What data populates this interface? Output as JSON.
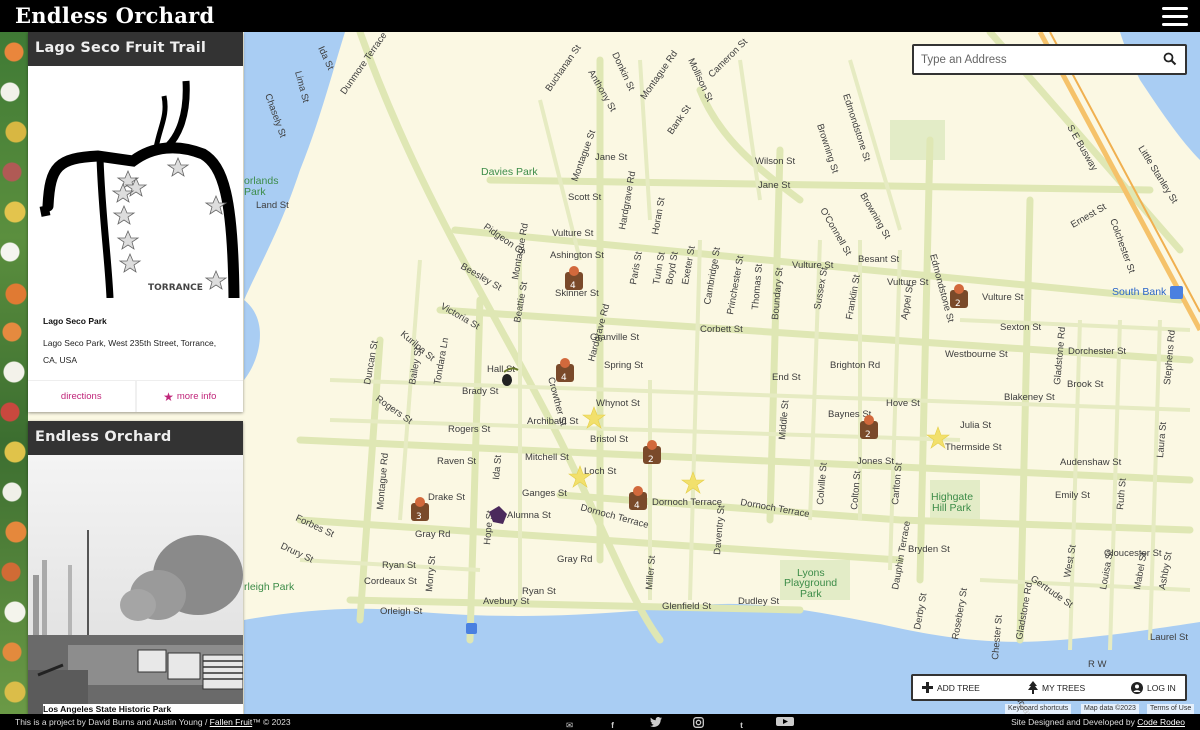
{
  "header": {
    "brand": "Endless Orchard"
  },
  "search": {
    "placeholder": "Type an Address"
  },
  "cards": [
    {
      "title": "Lago Seco Fruit Trail",
      "map_caption": "TORRANCE",
      "name": "Lago Seco Park",
      "address": "Lago Seco Park, West 235th Street, Torrance, CA, USA",
      "directions_label": "directions",
      "more_info_label": "more info"
    },
    {
      "title": "Endless Orchard",
      "photo_caption": "Los Angeles State Historic Park"
    }
  ],
  "map": {
    "streets": [
      "Lima St",
      "Chasely St",
      "Dunmore Terrace",
      "Buchanan St",
      "Anthony St",
      "Cameron St",
      "Donkin St",
      "Montague Rd",
      "Mollison St",
      "Bank St",
      "Edmondstone St",
      "Browning St",
      "S E Busway",
      "Little Stanley St",
      "Jane St",
      "Wilson St",
      "Scott St",
      "Land St",
      "Pidgeon Cl",
      "Ashington St",
      "Vulture St",
      "Hardgrave Rd",
      "Horan St",
      "O'Connell St",
      "Besant St",
      "Ernest St",
      "Colchester St",
      "Beesley St",
      "Skinner St",
      "Paris St",
      "Turin St",
      "Boyd St",
      "Exeter St",
      "Cambridge St",
      "Princhester St",
      "Thomas St",
      "Boundary St",
      "Sussex St",
      "Franklin St",
      "Appel St",
      "Hampstead Rd",
      "Victoria St",
      "Granville St",
      "Corbett St",
      "Sexton St",
      "Dorchester St",
      "Kurilpa St",
      "Duncan St",
      "Bailey St",
      "Tondara Ln",
      "Spring St",
      "Brighton Rd",
      "Westbourne St",
      "Gladstone Rd",
      "Brook St",
      "Hampton St",
      "End St",
      "Blakeney St",
      "Rogers St",
      "Brady St",
      "Whynot St",
      "Archibald St",
      "Bristol St",
      "Baynes St",
      "Hove St",
      "Julia St",
      "Thermside St",
      "Mitchell St",
      "Raven St",
      "Ida St",
      "Loch St",
      "Jones St",
      "Audenshaw St",
      "Drake St",
      "Ganges St",
      "Dornoch Terrace",
      "Forbes St",
      "Colville St",
      "Colton St",
      "Carlton St",
      "Emily St",
      "Ruth St",
      "Laura St",
      "Stephens Rd",
      "Alumna St",
      "Gray Rd",
      "Daventry St",
      "Bryden St",
      "Dauphin Terrace",
      "Ryan St",
      "Cordeaux St",
      "Morry St",
      "Miller St",
      "Gloucester St",
      "West St",
      "Louisa St",
      "Mabel St",
      "Orleigh St",
      "Avebury St",
      "Glenfield St",
      "Dudley St",
      "Gertrude St",
      "Derby St",
      "Rosebery St",
      "Chester St",
      "Laurel St",
      "Montague St",
      "Middle St",
      "Hall St",
      "R W",
      "Drury St"
    ],
    "parks": [
      "Davies Park",
      "Highgate Hill Park",
      "Lyons Playground Park",
      "Orlands Park",
      "rleigh Park"
    ],
    "places": [
      "South Bank"
    ],
    "tree_badges": [
      "4",
      "2",
      "4",
      "2",
      "2",
      "4",
      "3"
    ]
  },
  "actions": {
    "add_tree": "ADD TREE",
    "my_trees": "MY TREES",
    "log_in": "LOG IN"
  },
  "attribution": {
    "shortcuts": "Keyboard shortcuts",
    "map_data": "Map data ©2023",
    "terms": "Terms of Use"
  },
  "footer": {
    "credit_prefix": "This is a project by David Burns and Austin Young / ",
    "credit_link": "Fallen Fruit",
    "credit_suffix": "™ © 2023",
    "developer_prefix": "Site Designed and Developed by ",
    "developer_link": "Code Rodeo"
  }
}
